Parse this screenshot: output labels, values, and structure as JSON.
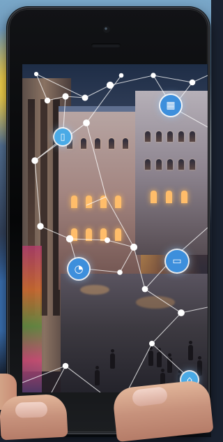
{
  "scene": {
    "subject": "smartphone-city-network",
    "icons": [
      {
        "id": "building",
        "name": "building-icon"
      },
      {
        "id": "phone",
        "name": "smartphone-icon"
      },
      {
        "id": "wifi",
        "name": "wifi-icon"
      },
      {
        "id": "laptop",
        "name": "laptop-icon"
      },
      {
        "id": "home",
        "name": "home-icon"
      }
    ],
    "colors": {
      "network_lines": "#ffffff",
      "icon_blue": "#3d8fdc",
      "icon_light_blue": "#4aaae6",
      "phone_body": "#0b0c0f",
      "warm_light": "#ffbd6a"
    }
  }
}
